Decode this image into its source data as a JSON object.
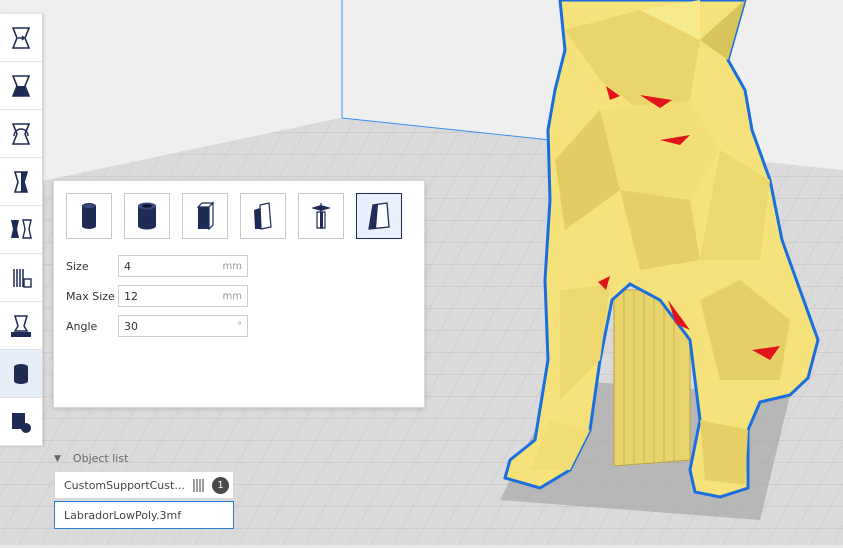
{
  "support_panel": {
    "types": [
      {
        "name": "cylinder",
        "selected": false
      },
      {
        "name": "tube",
        "selected": false
      },
      {
        "name": "cube",
        "selected": false
      },
      {
        "name": "abutment",
        "selected": false
      },
      {
        "name": "freeform",
        "selected": false
      },
      {
        "name": "custom",
        "selected": true
      }
    ],
    "params": {
      "size": {
        "label": "Size",
        "value": "4",
        "unit": "mm"
      },
      "max_size": {
        "label": "Max Size",
        "value": "12",
        "unit": "mm"
      },
      "angle": {
        "label": "Angle",
        "value": "30",
        "unit": "°"
      }
    }
  },
  "object_list": {
    "title": "Object list",
    "items": [
      {
        "label": "CustomSupportCust...",
        "badge": "1"
      },
      {
        "label": "LabradorLowPoly.3mf"
      }
    ]
  },
  "colors": {
    "model_fill": "#f5e27a",
    "model_outline": "#1a6fe0",
    "overhang": "#e0141a",
    "build_plate": "#d9d9d9",
    "accent": "#1f2a55"
  }
}
